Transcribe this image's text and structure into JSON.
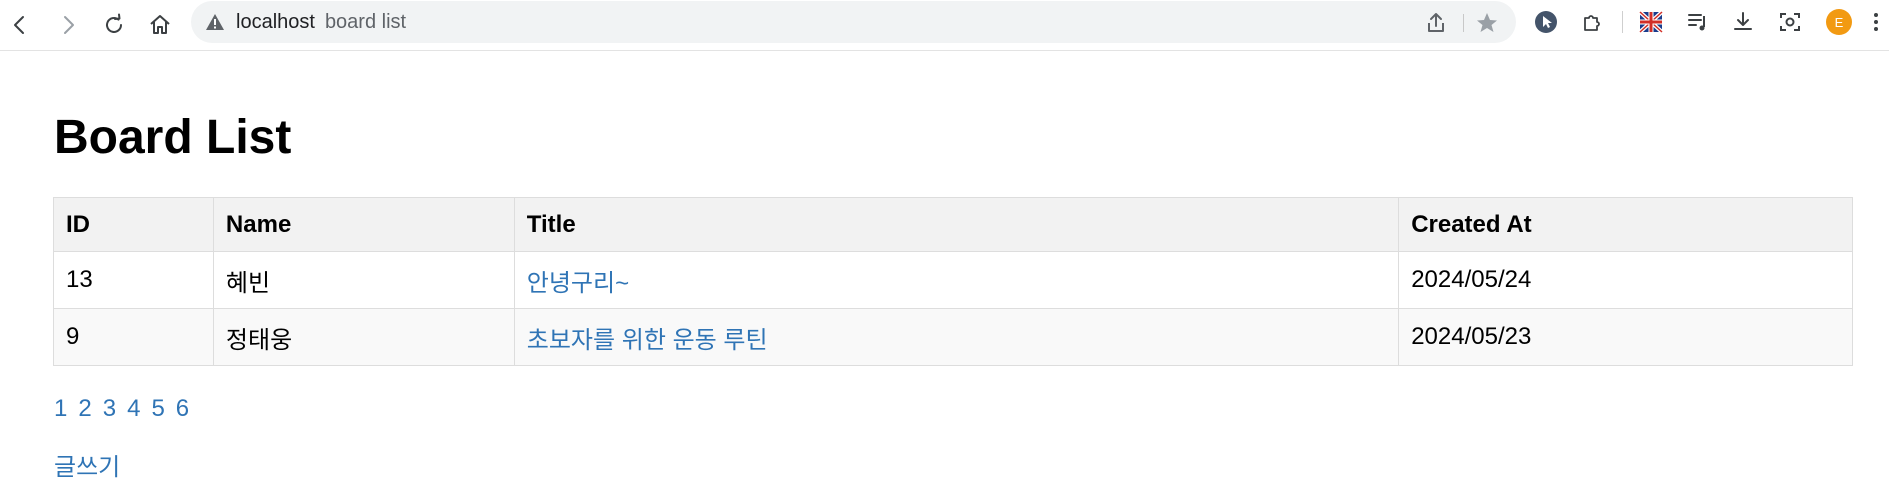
{
  "browser": {
    "url_host": "localhost",
    "url_path": "board list",
    "avatar_letter": "E"
  },
  "page": {
    "title": "Board List"
  },
  "table": {
    "headers": {
      "id": "ID",
      "name": "Name",
      "title": "Title",
      "created": "Created At"
    },
    "rows": [
      {
        "id": "13",
        "name": "혜빈",
        "title": "안녕구리~",
        "created": "2024/05/24"
      },
      {
        "id": "9",
        "name": "정태웅",
        "title": "초보자를 위한 운동 루틴",
        "created": "2024/05/23"
      }
    ]
  },
  "pagination": [
    "1",
    "2",
    "3",
    "4",
    "5",
    "6"
  ],
  "write_link": "글쓰기",
  "colors": {
    "link": "#2f74b5",
    "header_bg": "#f2f2f2",
    "avatar": "#f29a12"
  }
}
